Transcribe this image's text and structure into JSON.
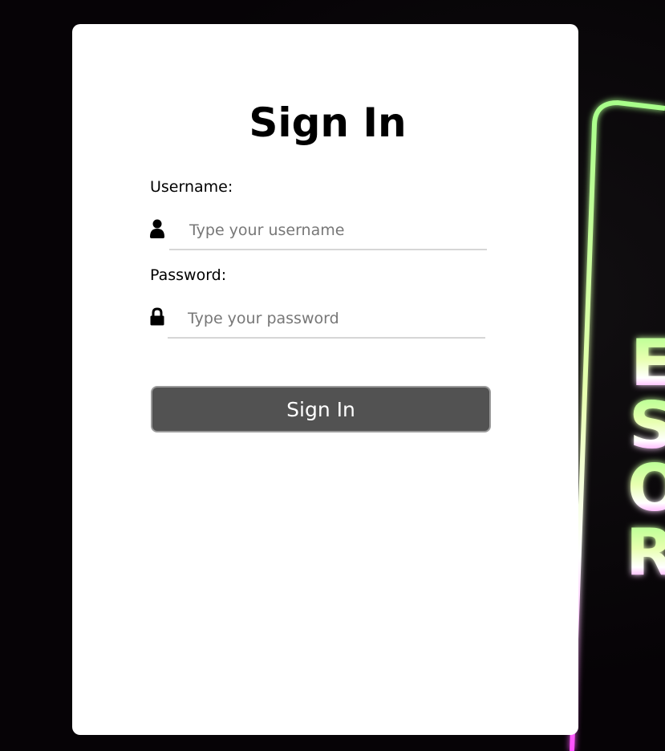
{
  "signin": {
    "title": "Sign In",
    "username": {
      "label": "Username:",
      "placeholder": "Type your username",
      "icon": "user-icon"
    },
    "password": {
      "label": "Password:",
      "placeholder": "Type your password",
      "icon": "lock-icon"
    },
    "submit_label": "Sign In"
  },
  "background": {
    "neon_letters": [
      "E",
      "S",
      "O",
      "R"
    ]
  },
  "colors": {
    "button": "#525252",
    "card": "#ffffff",
    "neon_green": "#b6ff9a",
    "neon_magenta": "#ff5cff"
  }
}
